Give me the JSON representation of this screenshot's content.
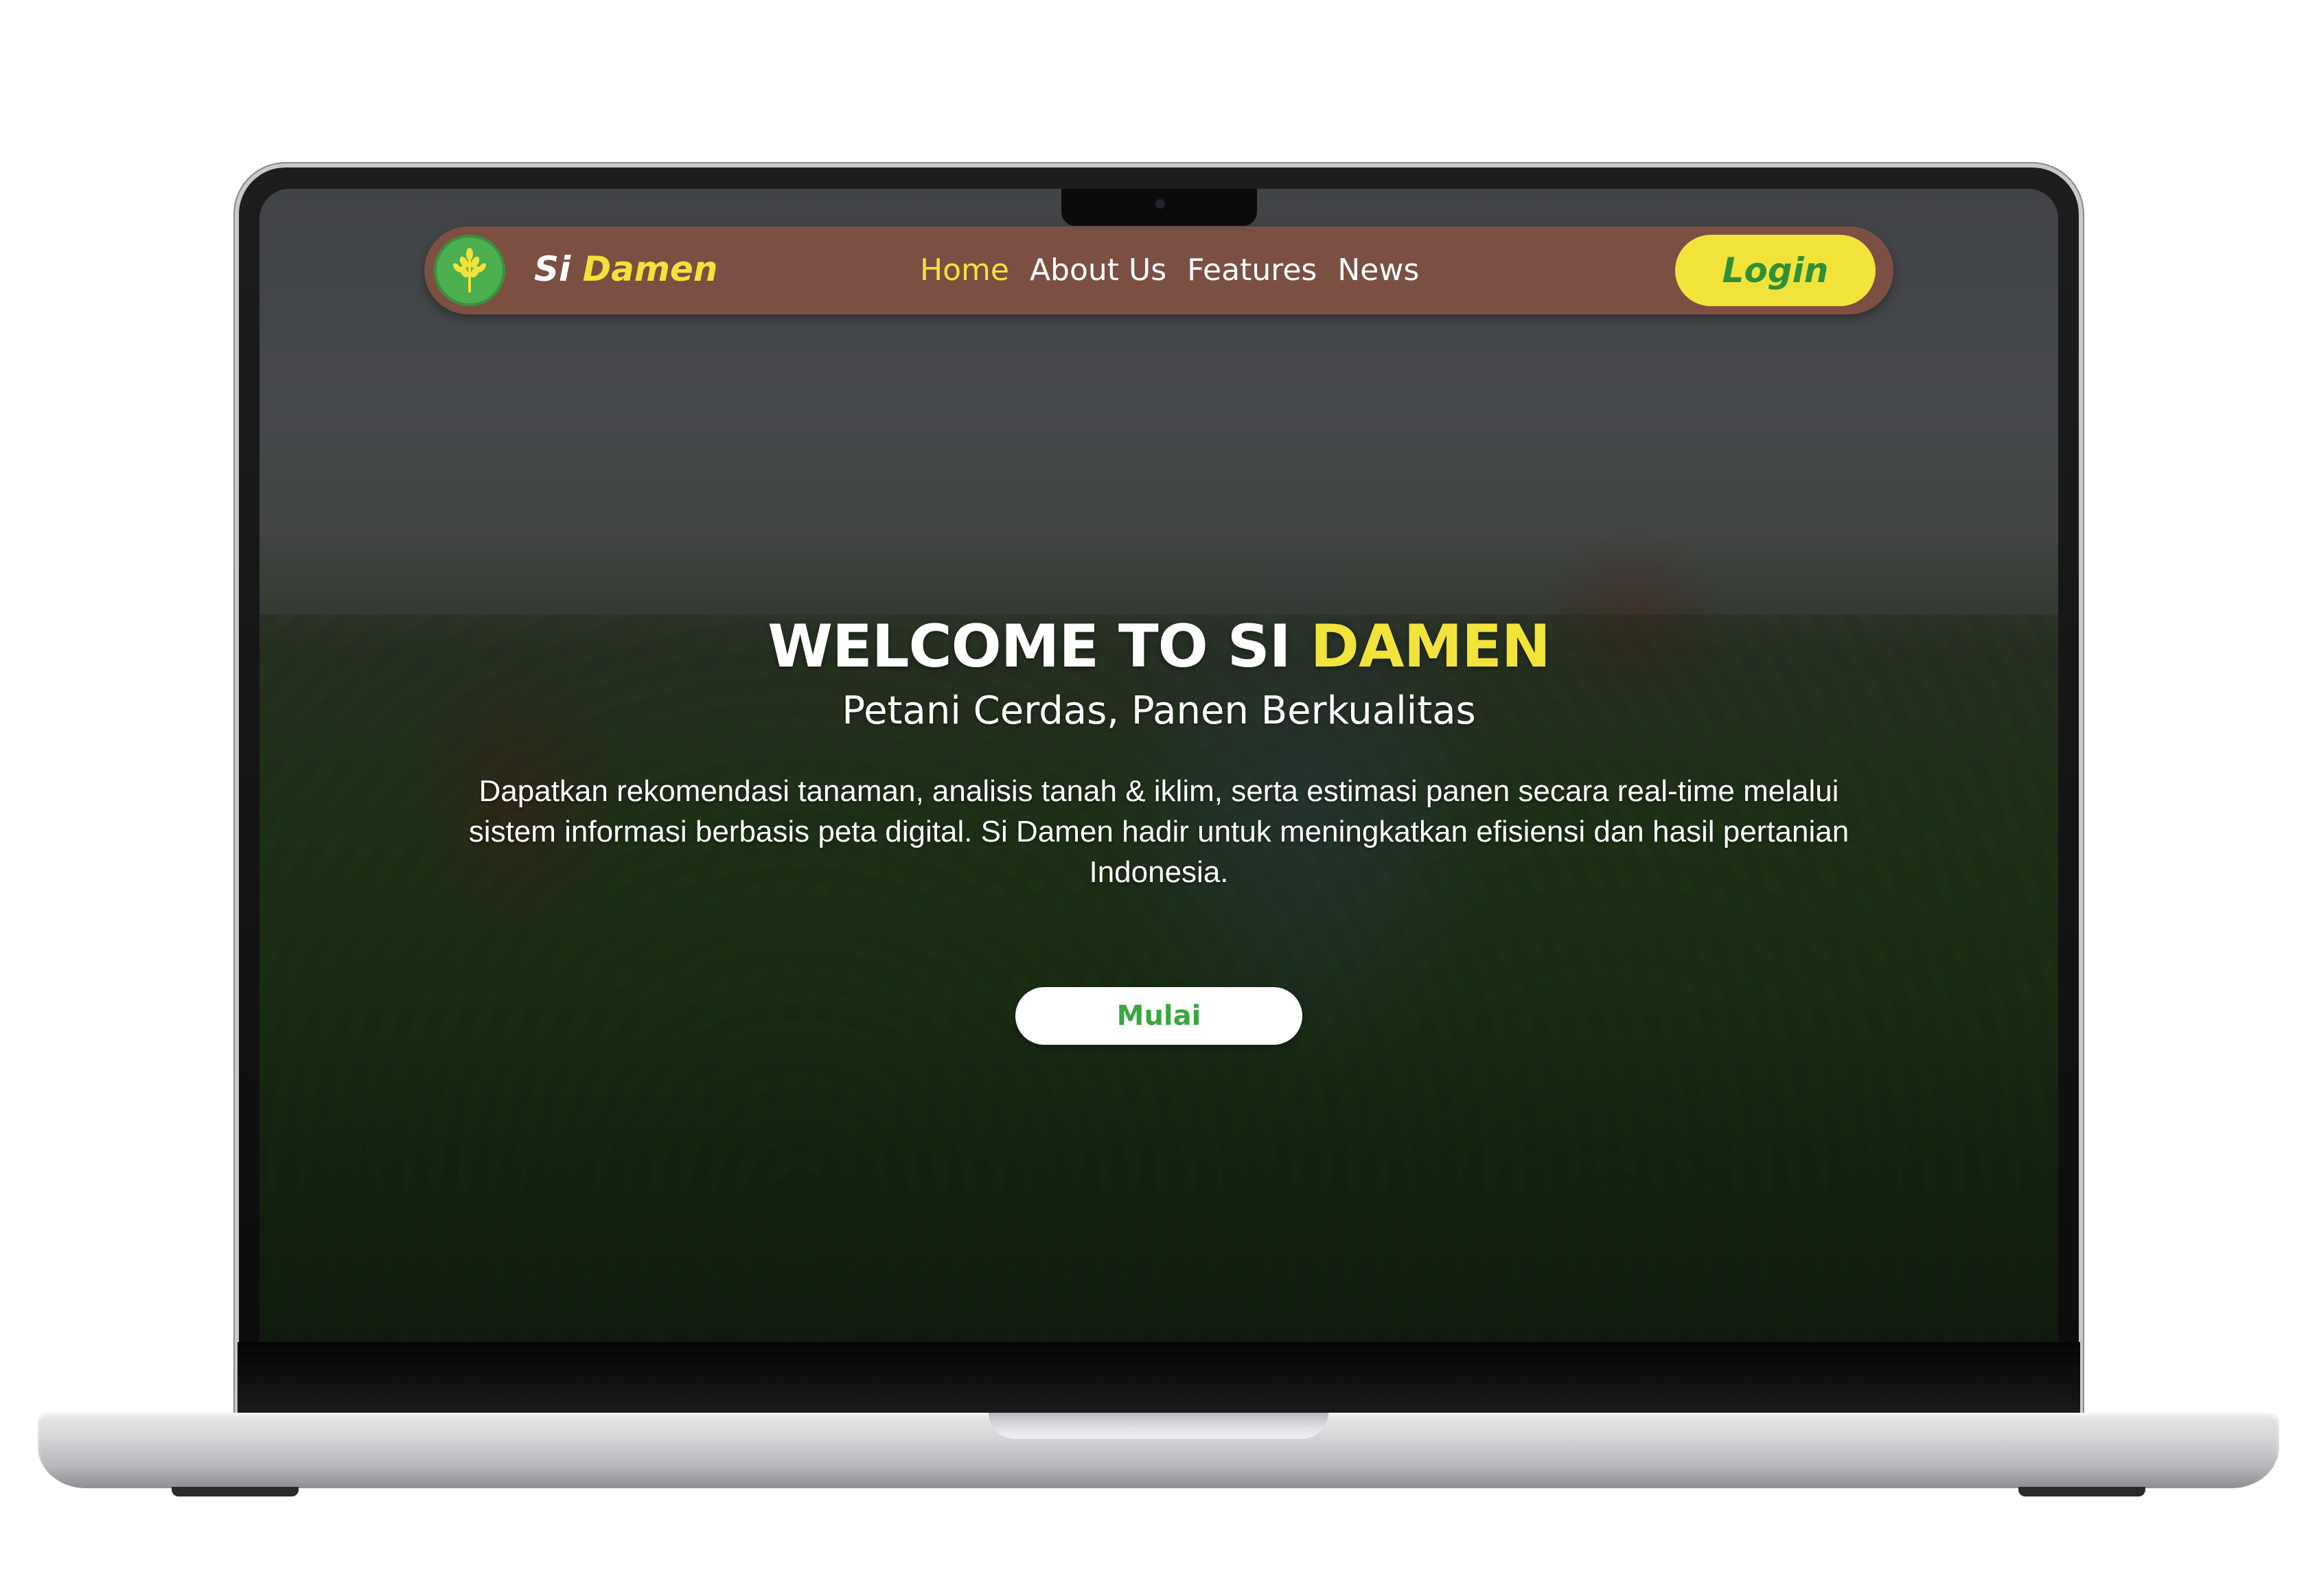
{
  "brand": {
    "name_first": "Si",
    "name_second": "Damen",
    "logo_icon": "wheat-icon"
  },
  "nav": {
    "items": [
      {
        "label": "Home",
        "active": true
      },
      {
        "label": "About Us",
        "active": false
      },
      {
        "label": "Features",
        "active": false
      },
      {
        "label": "News",
        "active": false
      }
    ],
    "login_label": "Login"
  },
  "hero": {
    "title_part1": "WELCOME TO SI",
    "title_part2": "DAMEN",
    "subtitle": "Petani Cerdas, Panen Berkualitas",
    "description": "Dapatkan rekomendasi tanaman, analisis tanah & iklim, serta estimasi panen secara real-time melalui sistem informasi berbasis peta digital. Si Damen hadir untuk meningkatkan efisiensi dan hasil pertanian Indonesia.",
    "cta_label": "Mulai"
  },
  "colors": {
    "navbar": "#7b5043",
    "accent_yellow": "#f2e33b",
    "accent_green": "#3aa63f"
  }
}
